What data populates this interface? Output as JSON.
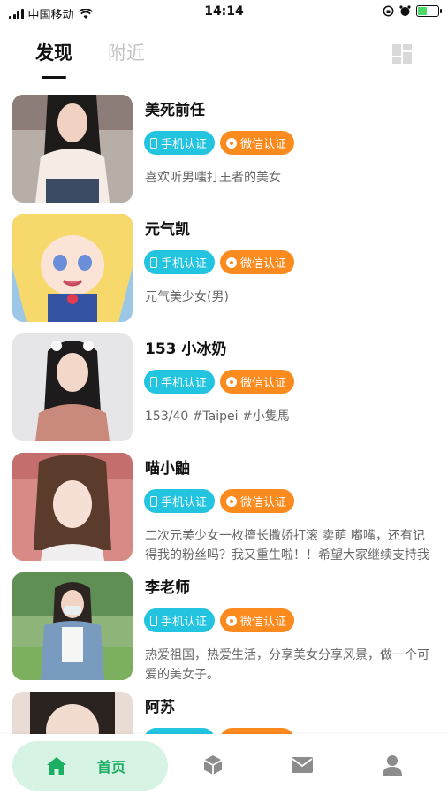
{
  "status_bar": {
    "carrier": "中国移动",
    "time": "14:14",
    "battery_percent": 0.45
  },
  "header": {
    "tabs": [
      {
        "label": "发现",
        "active": true
      },
      {
        "label": "附近",
        "active": false
      }
    ],
    "grid_icon": "layout-grid-icon"
  },
  "badges": {
    "phone_label": "手机认证",
    "wechat_label": "微信认证",
    "phone_color": "#22c4e0",
    "wechat_color": "#fb8a1f"
  },
  "users": [
    {
      "name": "美死前任",
      "desc": "喜欢听男嗤打王者的美女"
    },
    {
      "name": "元气凯",
      "desc": "元气美少女(男)"
    },
    {
      "name": "153 小冰奶",
      "desc": "153/40   #Taipei #小隻馬"
    },
    {
      "name": "喵小鼬",
      "desc": "二次元美少女一枚擅长撒娇打滚 卖萌 嘟嘴，还有记得我的粉丝吗？我又重生啦！！希望大家继续支持我"
    },
    {
      "name": "李老师",
      "desc": "热爱祖国，热爱生活，分享美女分享风景，做一个可爱的美女子。"
    },
    {
      "name": "阿苏",
      "desc": ""
    }
  ],
  "bottom_nav": {
    "home_label": "首页",
    "accent_color": "#1cae63",
    "items": [
      "home-icon",
      "cube-icon",
      "mail-icon",
      "profile-icon"
    ]
  }
}
